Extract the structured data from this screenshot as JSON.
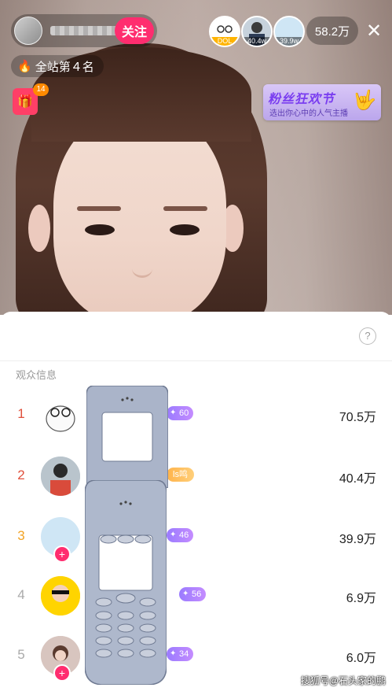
{
  "header": {
    "follow_label": "关注",
    "viewer_counts": [
      "40.4w",
      "39.9w"
    ],
    "top_viewer_tag": "DOL",
    "online_count": "58.2万",
    "close_icon": "close-icon"
  },
  "rank_badge": {
    "label": "全站第４名",
    "icon": "fire-icon"
  },
  "gift": {
    "badge_count": "14"
  },
  "banner": {
    "title": "粉丝狂欢节",
    "subtitle": "选出你心中的人气主播"
  },
  "panel": {
    "help_icon": "question-icon",
    "section_title": "观众信息",
    "rows": [
      {
        "rank": "1",
        "level": "60",
        "fan_tag": "",
        "value": "70.5万",
        "rank_color": "#e0503c"
      },
      {
        "rank": "2",
        "level": "",
        "fan_tag": "ls鸣",
        "value": "40.4万",
        "rank_color": "#e0503c"
      },
      {
        "rank": "3",
        "level": "46",
        "fan_tag": "",
        "value": "39.9万",
        "rank_color": "#f2a324"
      },
      {
        "rank": "4",
        "level": "56",
        "fan_tag": "",
        "value": "6.9万",
        "rank_color": "#aaaaaa"
      },
      {
        "rank": "5",
        "level": "34",
        "fan_tag": "",
        "value": "6.0万",
        "rank_color": "#aaaaaa"
      }
    ]
  },
  "watermark": "搜狐号@石头家的鹏"
}
